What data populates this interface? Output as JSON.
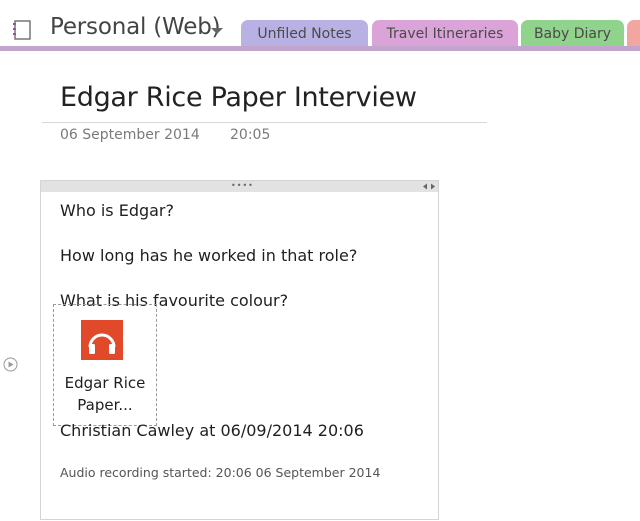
{
  "notebook": {
    "title": "Personal (Web)"
  },
  "tabs": [
    {
      "label": "Unfiled Notes",
      "color": "#b9b1e4"
    },
    {
      "label": "Travel Itineraries",
      "color": "#dba4d8"
    },
    {
      "label": "Baby Diary",
      "color": "#8fd38d"
    },
    {
      "label": "",
      "color": "#f3a5a0"
    }
  ],
  "page": {
    "title": "Edgar Rice Paper Interview",
    "date": "06 September 2014",
    "time": "20:05"
  },
  "note": {
    "lines": [
      "Who is Edgar?",
      "How long has he worked in that role?",
      "What is his favourite colour?"
    ],
    "audio_attachment": {
      "label_line1": "Edgar Rice",
      "label_line2": "Paper...",
      "icon": "headphones-icon",
      "icon_color": "#e04a2a"
    },
    "author_line": "Christian Cawley at 06/09/2014 20:06",
    "audio_started": "Audio recording started: 20:06 06 September 2014"
  }
}
